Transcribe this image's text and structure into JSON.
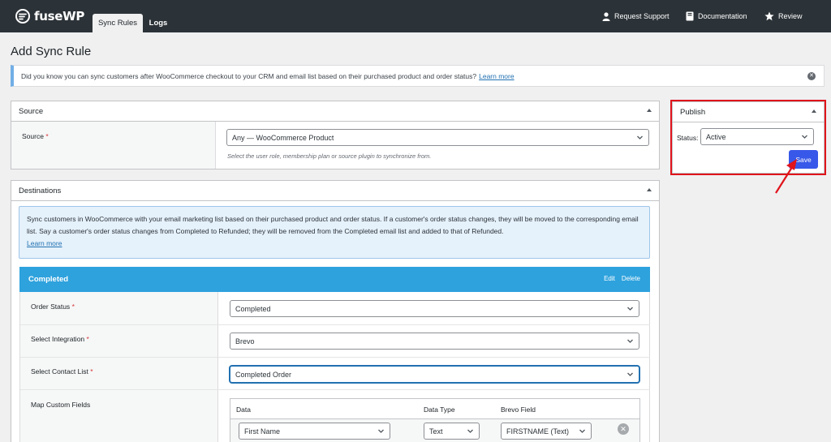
{
  "header": {
    "logo_text": "fuseWP",
    "tabs": [
      {
        "label": "Sync Rules",
        "active": true
      },
      {
        "label": "Logs",
        "active": false
      }
    ],
    "links": [
      {
        "label": "Request Support",
        "icon": "user-icon"
      },
      {
        "label": "Documentation",
        "icon": "book-icon"
      },
      {
        "label": "Review",
        "icon": "star-icon"
      }
    ]
  },
  "page_title": "Add Sync Rule",
  "notice": {
    "text": "Did you know you can sync customers after WooCommerce checkout to your CRM and email list based on their purchased product and order status?",
    "link": "Learn more"
  },
  "source_box": {
    "title": "Source",
    "field_label": "Source",
    "required_mark": "*",
    "value": "Any — WooCommerce Product",
    "description": "Select the user role, membership plan or source plugin to synchronize from."
  },
  "destinations_box": {
    "title": "Destinations",
    "info_text": "Sync customers in WooCommerce with your email marketing list based on their purchased product and order status. If a customer's order status changes, they will be moved to the corresponding email list. Say a customer's order status changes from Completed to Refunded; they will be removed from the Completed email list and added to that of Refunded.",
    "info_link": "Learn more",
    "rule": {
      "title": "Completed",
      "edit_label": "Edit",
      "delete_label": "Delete",
      "fields": [
        {
          "label": "Order Status",
          "required": true,
          "value": "Completed"
        },
        {
          "label": "Select Integration",
          "required": true,
          "value": "Brevo"
        },
        {
          "label": "Select Contact List",
          "required": true,
          "value": "Completed Order"
        }
      ],
      "map_label": "Map Custom Fields",
      "map_columns": [
        "Data",
        "Data Type",
        "Brevo Field"
      ],
      "map_rows": [
        {
          "data": "First Name",
          "type": "Text",
          "field": "FIRSTNAME (Text)"
        }
      ]
    }
  },
  "publish_box": {
    "title": "Publish",
    "status_label": "Status:",
    "status_value": "Active",
    "save_label": "Save"
  },
  "colors": {
    "topbar": "#2c3338",
    "accent_blue": "#2ea2dd",
    "save_button": "#3858e9",
    "annotation_red": "#e0141b"
  }
}
